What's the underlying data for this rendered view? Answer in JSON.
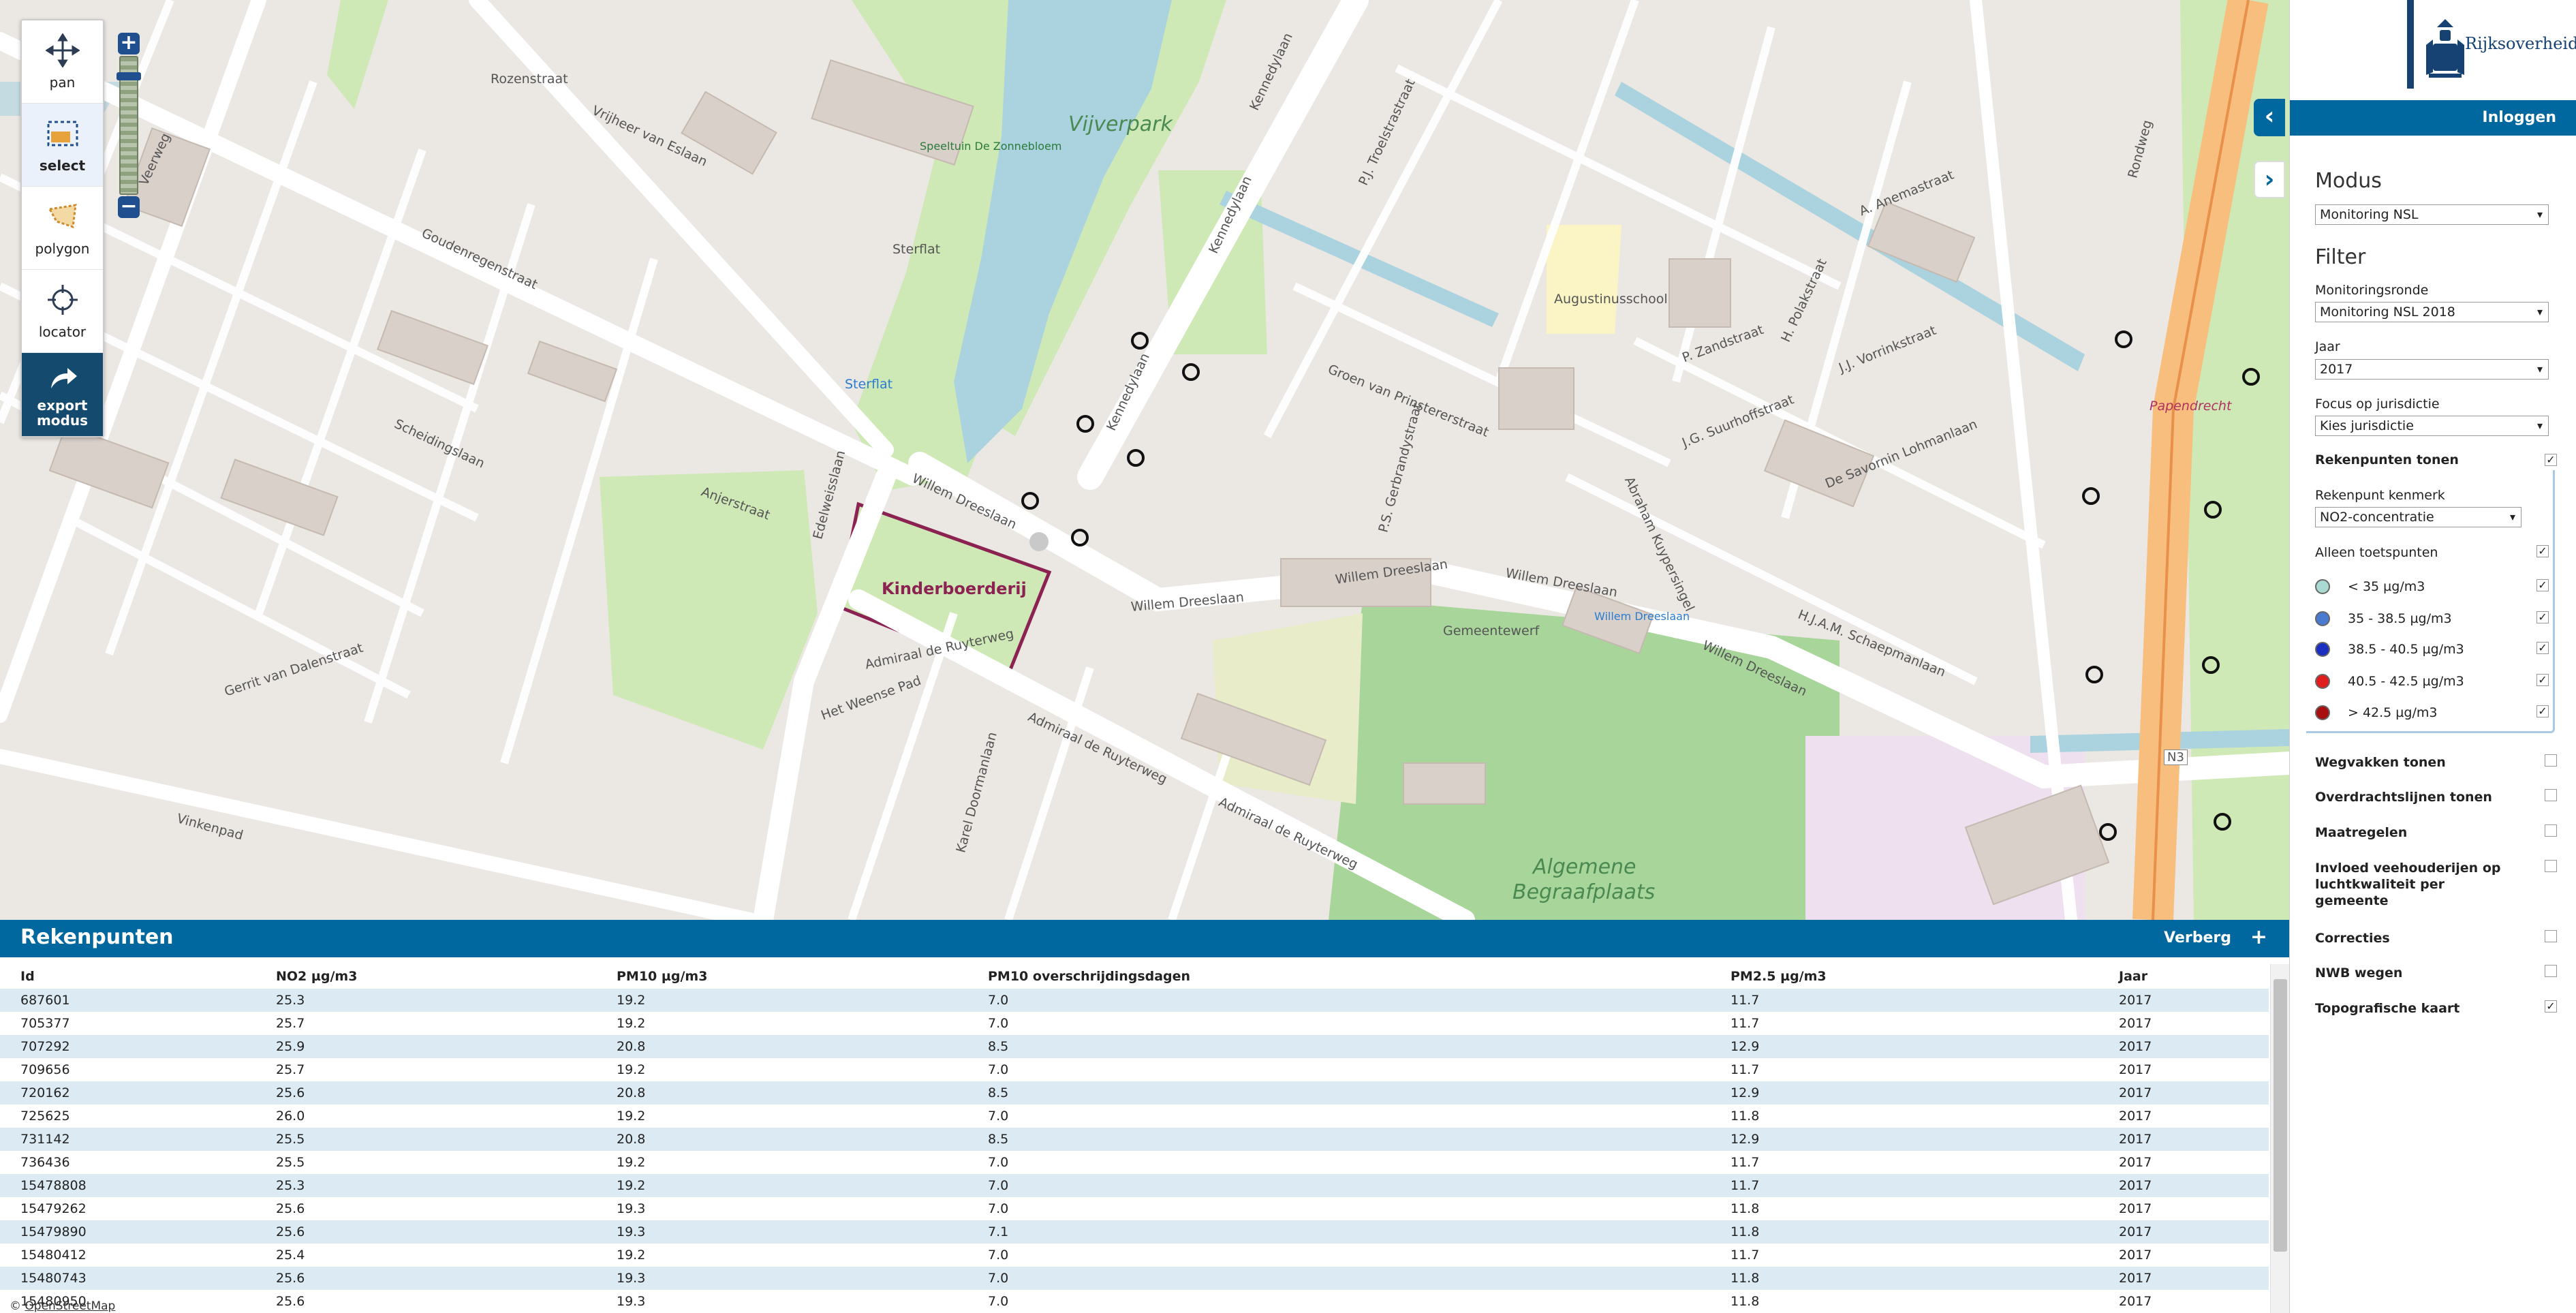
{
  "map": {
    "toolbar": [
      {
        "label": "pan",
        "icon": "pan-arrows-icon"
      },
      {
        "label": "select",
        "icon": "select-box-icon"
      },
      {
        "label": "polygon",
        "icon": "polygon-icon"
      },
      {
        "label": "locator",
        "icon": "crosshair-icon"
      },
      {
        "label": "export modus",
        "icon": "share-arrow-icon"
      }
    ],
    "zoom_in": "+",
    "zoom_out": "−",
    "labels": {
      "vijverpark": "Vijverpark",
      "kinderboerderij": "Kinderboerderij",
      "algemene": "Algemene",
      "begraafplaats": "Begraafplaats",
      "augustinusschool": "Augustinusschool",
      "willem_dreeslaan_1": "Willem Dreeslaan",
      "willem_dreeslaan_2": "Willem Dreeslaan",
      "willem_dreeslaan_3": "Willem Dreeslaan",
      "willem_dreeslaan_4": "Willem Dreeslaan",
      "willem_dreeslaan_5": "Willem Dreeslaan",
      "admiraal_1": "Admiraal de Ruyterweg",
      "admiraal_2": "Admiraal de Ruyterweg",
      "admiraal_3": "Admiraal de Ruyterweg",
      "kennedylaan_1": "Kennedylaan",
      "kennedylaan_2": "Kennedylaan",
      "kennedylaan_3": "Kennedylaan",
      "vrijheer": "Vrijheer van Eslaan",
      "scheidingslaan": "Scheidingslaan",
      "goudenregen": "Goudenregenstraat",
      "groen": "Groen van Prinstererstraat",
      "de_savornin": "De Savornin Lohmanlaan",
      "schaepman": "H.J.A.M. Schaepmanlaan",
      "gemeentewerf": "Gemeentewerf",
      "rozenstraat": "Rozenstraat",
      "sterflat": "Sterflat",
      "speeltuin": "Speeltuin De Zonnebloem",
      "rondweg": "Rondweg",
      "papendrecht": "Papendrecht",
      "n3": "N3",
      "gerrit": "Gerrit van Dalenstraat",
      "vinkenpad": "Vinkenpad",
      "anjerstraat": "Anjerstraat",
      "weense": "Het Weense Pad",
      "edelweisslaan": "Edelweisslaan",
      "karel": "Karel Doormanlaan",
      "polak": "H. Polakstraat",
      "zandstraat": "P. Zandstraat",
      "vorrink": "J.J. Vorrinkstraat",
      "suurhoff": "J.G. Suurhoffstraat",
      "anemastraat": "A. Anemastraat",
      "kuyper": "Abraham Kuypersingel",
      "troelstra": "P.J. Troelstrastraat",
      "gerbrandy": "P.S. Gerbrandystraat",
      "veerweg": "Veerweg",
      "sterflat_stop": "Sterflat",
      "willem_stop": "Willem Dreeslaan"
    }
  },
  "panel": {
    "brand": "Rijksoverheid",
    "login": "Inloggen",
    "modus_heading": "Modus",
    "modus_value": "Monitoring NSL",
    "filter_heading": "Filter",
    "monitoringsronde_label": "Monitoringsronde",
    "monitoringsronde_value": "Monitoring NSL 2018",
    "jaar_label": "Jaar",
    "jaar_value": "2017",
    "focus_label": "Focus op jurisdictie",
    "focus_value": "Kies jurisdictie",
    "rekenpunten_tonen": "Rekenpunten tonen",
    "kenmerk_label": "Rekenpunt kenmerk",
    "kenmerk_value": "NO2-concentratie",
    "alleen_toetspunten": "Alleen toetspunten",
    "legend": [
      {
        "label": "< 35 µg/m3",
        "color": "#a9d9d0"
      },
      {
        "label": "35 - 38.5 µg/m3",
        "color": "#4b7bd1"
      },
      {
        "label": "38.5 - 40.5 µg/m3",
        "color": "#1a2fbf"
      },
      {
        "label": "40.5 - 42.5 µg/m3",
        "color": "#e11c1c"
      },
      {
        "label": "> 42.5 µg/m3",
        "color": "#a80f0f"
      }
    ],
    "layers": [
      {
        "label": "Wegvakken tonen",
        "checked": false
      },
      {
        "label": "Overdrachtslijnen tonen",
        "checked": false
      },
      {
        "label": "Maatregelen",
        "checked": false
      },
      {
        "label": "Invloed veehouderijen op luchtkwaliteit per gemeente",
        "checked": false
      },
      {
        "label": "Correcties",
        "checked": false
      },
      {
        "label": "NWB wegen",
        "checked": false
      },
      {
        "label": "Topografische kaart",
        "checked": true
      }
    ],
    "check_mark": "✓",
    "collapse_left": "‹",
    "collapse_right": "›"
  },
  "table": {
    "title": "Rekenpunten",
    "hide_label": "Verberg",
    "plus_label": "+",
    "columns": [
      "Id",
      "NO2 µg/m3",
      "PM10 µg/m3",
      "PM10 overschrijdingsdagen",
      "PM2.5 µg/m3",
      "Jaar"
    ],
    "rows": [
      [
        "687601",
        "25.3",
        "19.2",
        "7.0",
        "11.7",
        "2017"
      ],
      [
        "705377",
        "25.7",
        "19.2",
        "7.0",
        "11.7",
        "2017"
      ],
      [
        "707292",
        "25.9",
        "20.8",
        "8.5",
        "12.9",
        "2017"
      ],
      [
        "709656",
        "25.7",
        "19.2",
        "7.0",
        "11.7",
        "2017"
      ],
      [
        "720162",
        "25.6",
        "20.8",
        "8.5",
        "12.9",
        "2017"
      ],
      [
        "725625",
        "26.0",
        "19.2",
        "7.0",
        "11.8",
        "2017"
      ],
      [
        "731142",
        "25.5",
        "20.8",
        "8.5",
        "12.9",
        "2017"
      ],
      [
        "736436",
        "25.5",
        "19.2",
        "7.0",
        "11.7",
        "2017"
      ],
      [
        "15478808",
        "25.3",
        "19.2",
        "7.0",
        "11.7",
        "2017"
      ],
      [
        "15479262",
        "25.6",
        "19.3",
        "7.0",
        "11.8",
        "2017"
      ],
      [
        "15479890",
        "25.6",
        "19.3",
        "7.1",
        "11.8",
        "2017"
      ],
      [
        "15480412",
        "25.4",
        "19.2",
        "7.0",
        "11.7",
        "2017"
      ],
      [
        "15480743",
        "25.6",
        "19.3",
        "7.0",
        "11.8",
        "2017"
      ],
      [
        "15480950",
        "25.6",
        "19.3",
        "7.0",
        "11.8",
        "2017"
      ]
    ],
    "attribution_prefix": "© ",
    "attribution": "OpenStreetMap"
  }
}
